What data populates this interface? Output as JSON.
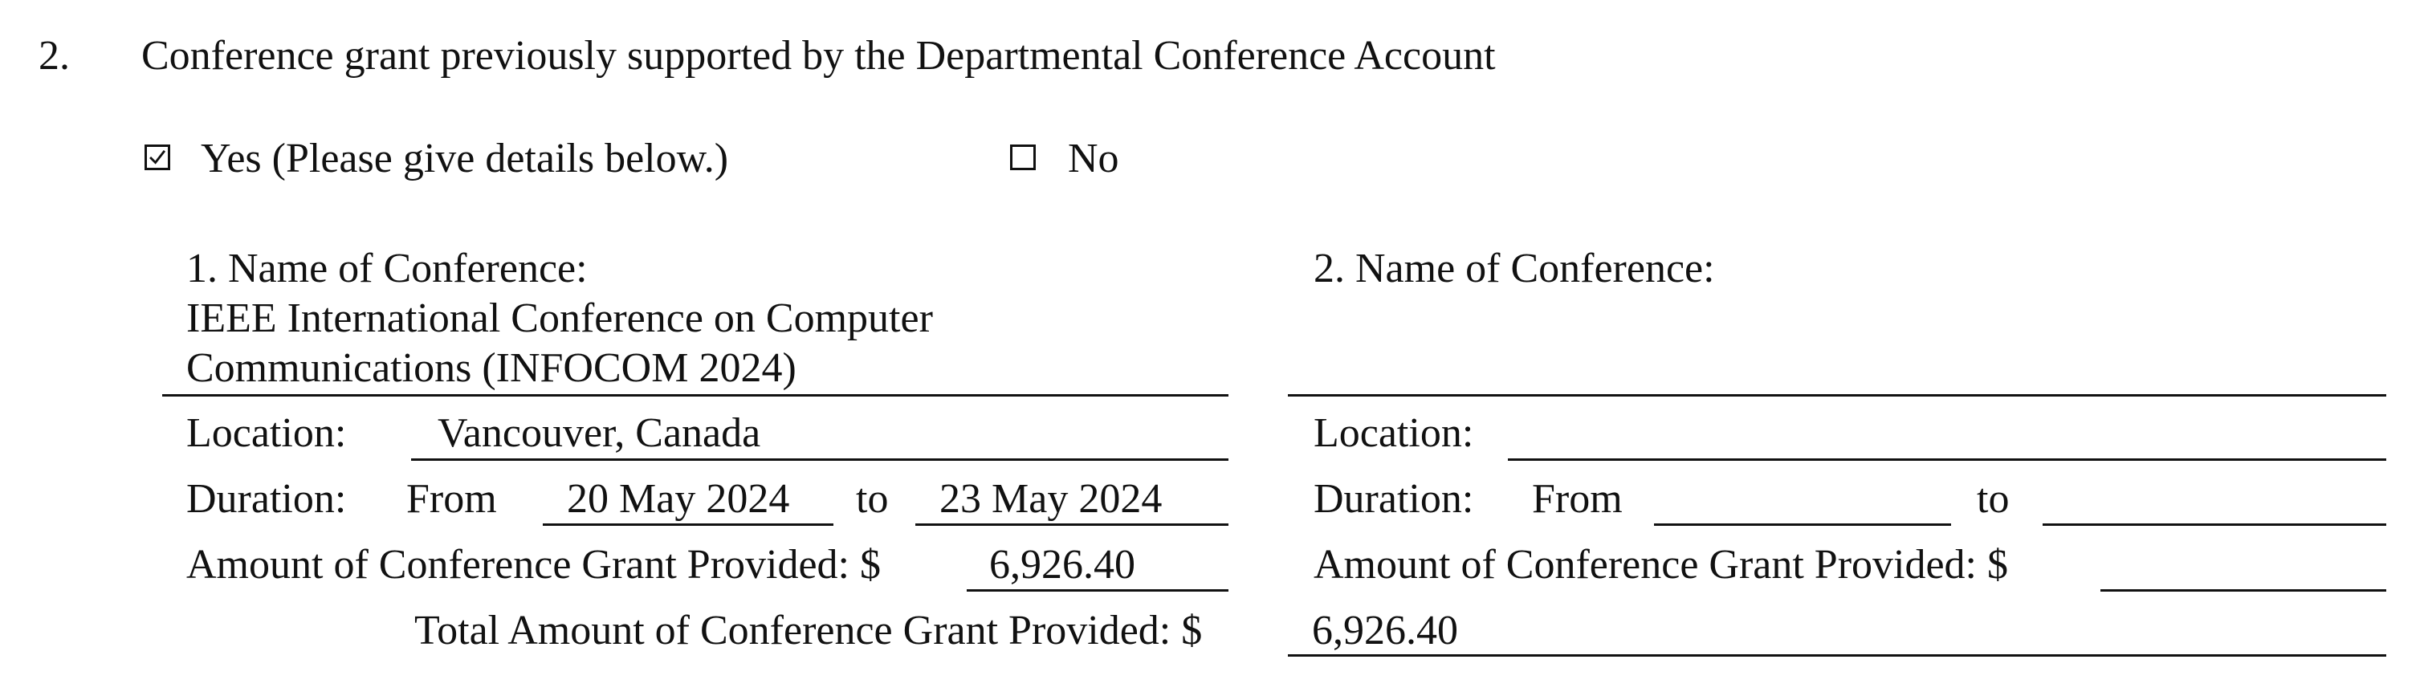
{
  "section": {
    "number": "2.",
    "title": "Conference grant previously supported by the Departmental Conference Account"
  },
  "options": {
    "yes": {
      "label": "Yes (Please give details below.)",
      "checked": true
    },
    "no": {
      "label": "No",
      "checked": false
    }
  },
  "conference1": {
    "heading": "1. Name of Conference:",
    "name_line1": "IEEE International Conference on Computer",
    "name_line2": "Communications (INFOCOM 2024)",
    "location_label": "Location:",
    "location_value": "Vancouver, Canada",
    "duration_label": "Duration:",
    "from_label": "From",
    "from_value": "20 May 2024",
    "to_label": "to",
    "to_value": "23 May 2024",
    "amount_label": "Amount of Conference Grant Provided: $",
    "amount_value": "6,926.40"
  },
  "conference2": {
    "heading": "2. Name of Conference:",
    "location_label": "Location:",
    "location_value": "",
    "duration_label": "Duration:",
    "from_label": "From",
    "from_value": "",
    "to_label": "to",
    "to_value": "",
    "amount_label": "Amount of Conference Grant Provided: $",
    "amount_value": ""
  },
  "total": {
    "label": "Total Amount of Conference Grant Provided: $",
    "value": "6,926.40"
  }
}
